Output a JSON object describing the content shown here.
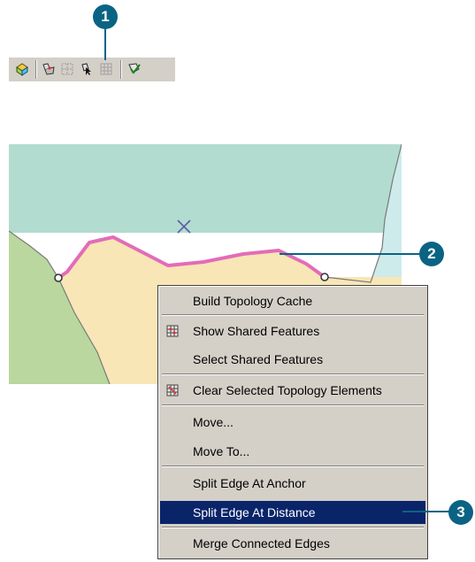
{
  "toolbar": {
    "icons": [
      "topology-tool-icon",
      "map-topology-icon",
      "topology-edit-icon",
      "topology-pointer-icon",
      "topology-grid-icon",
      "validate-topology-icon"
    ]
  },
  "callouts": {
    "one": "1",
    "two": "2",
    "three": "3"
  },
  "map": {
    "colors": {
      "north": "#b2dccf",
      "east": "#cdebea",
      "south": "#f8e6b6",
      "west": "#b9d79f",
      "selected_edge": "#e36cb8"
    }
  },
  "context_menu": {
    "items": [
      {
        "label": "Build Topology Cache"
      },
      {
        "label": "Show Shared Features",
        "icon": "shared-features-icon"
      },
      {
        "label": "Select Shared Features"
      },
      {
        "label": "Clear Selected Topology Elements",
        "icon": "clear-topology-icon"
      },
      {
        "label": "Move..."
      },
      {
        "label": "Move To..."
      },
      {
        "label": "Split Edge At Anchor"
      },
      {
        "label": "Split Edge At Distance",
        "selected": true
      },
      {
        "label": "Merge Connected Edges"
      }
    ]
  }
}
